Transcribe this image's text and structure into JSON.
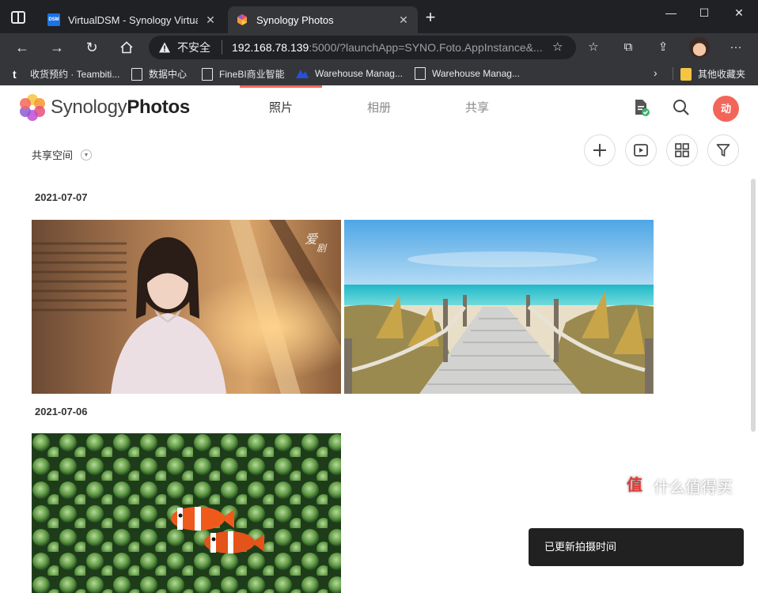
{
  "browser": {
    "tabs": [
      {
        "title": "VirtualDSM - Synology VirtualDS",
        "favicon_text": "DSM",
        "active": false
      },
      {
        "title": "Synology Photos",
        "active": true
      }
    ],
    "address": {
      "security_label": "不安全",
      "url_host": "192.168.78.139",
      "url_rest": ":5000/?launchApp=SYNO.Foto.AppInstance&..."
    },
    "bookmarks": [
      {
        "label": "收货预约 · Teambiti...",
        "icon": "t-icon"
      },
      {
        "label": "数据中心",
        "icon": "doc-icon"
      },
      {
        "label": "FineBI商业智能",
        "icon": "doc-icon"
      },
      {
        "label": "Warehouse Manag...",
        "icon": "warehouse-icon"
      },
      {
        "label": "Warehouse Manag...",
        "icon": "doc-icon"
      },
      {
        "label": "其他收藏夹",
        "icon": "folder-icon"
      }
    ]
  },
  "app": {
    "brand_light": "Synology",
    "brand_bold": "Photos",
    "nav_tabs": [
      {
        "label": "照片",
        "active": true
      },
      {
        "label": "相册",
        "active": false
      },
      {
        "label": "共享",
        "active": false
      }
    ],
    "avatar_text": "动",
    "space_selector": "共享空间",
    "accent_color": "#f5675a",
    "groups": [
      {
        "date": "2021-07-07",
        "photos": [
          "portrait-photo",
          "beach-boardwalk-photo"
        ]
      },
      {
        "date": "2021-07-06",
        "photos": [
          "clownfish-anemone-photo"
        ]
      }
    ],
    "toast": "已更新拍摄时间"
  },
  "watermark": {
    "logo_text": "值",
    "text": "什么值得买"
  }
}
